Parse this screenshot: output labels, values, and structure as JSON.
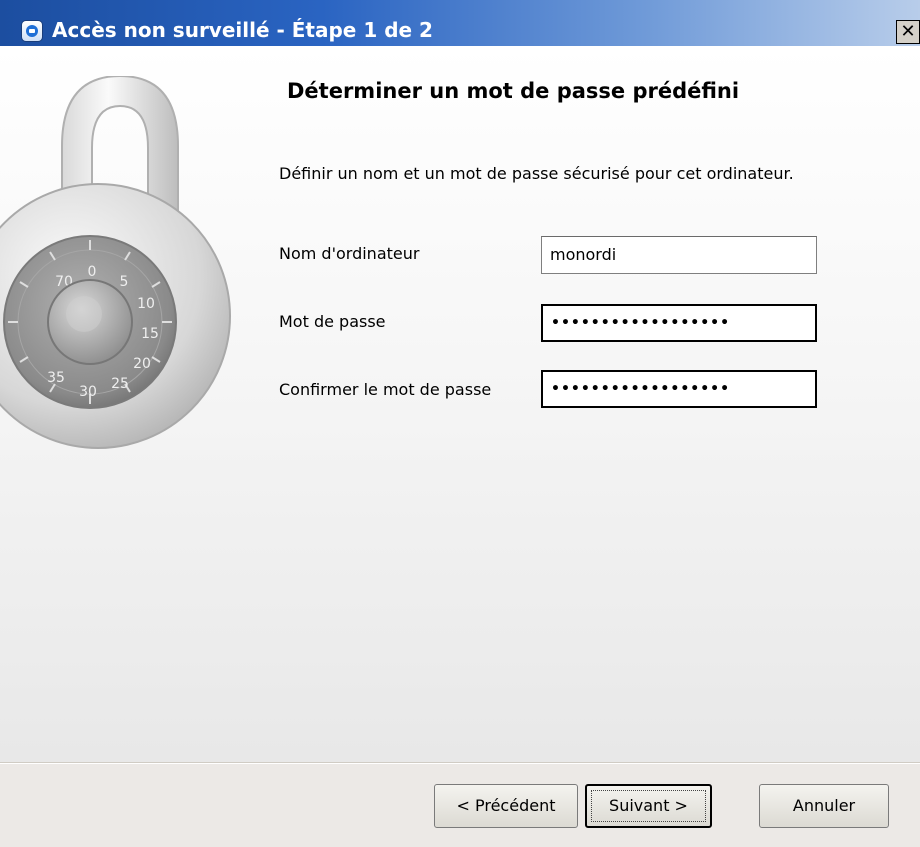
{
  "window": {
    "title": "Accès non surveillé - Étape 1 de 2",
    "close_label": "✕"
  },
  "main": {
    "heading": "Déterminer un mot de passe prédéfini",
    "description": "Définir un nom et un mot de passe sécurisé pour cet ordinateur.",
    "lock_dial_numbers": [
      "0",
      "5",
      "10",
      "15",
      "20",
      "25",
      "30",
      "35",
      "70"
    ],
    "fields": [
      {
        "label": "Nom d'ordinateur",
        "value": "monordi"
      },
      {
        "label": "Mot de passe",
        "value": "••••••••••••••••••"
      },
      {
        "label": "Confirmer le mot de passe",
        "value": "••••••••••••••••••"
      }
    ]
  },
  "footer": {
    "previous_label": "< Précédent",
    "next_label": "Suivant >",
    "cancel_label": "Annuler"
  },
  "colors": {
    "titlebar_start": "#1c4ea0",
    "titlebar_end": "#b8cdea",
    "window_bg": "#ece9e6"
  },
  "icons": {
    "app": "teamviewer-icon",
    "illustration": "padlock-icon"
  }
}
